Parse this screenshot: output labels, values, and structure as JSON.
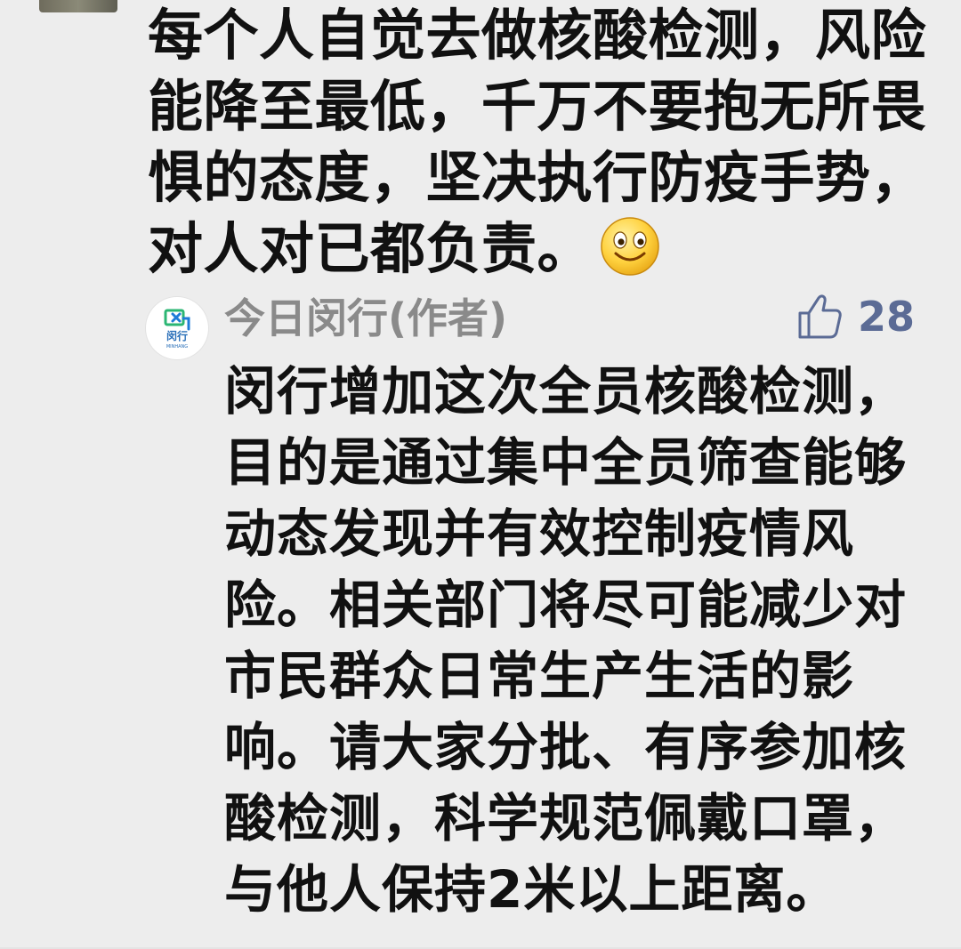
{
  "comment": {
    "text": "每个人自觉去做核酸检测，风险能降至最低，千万不要抱无所畏惧的态度，坚决执行防疫手势，对人对已都负责。",
    "emoji": "smile-emoji"
  },
  "reply": {
    "author": "今日闵行(作者)",
    "avatar_logo": {
      "name": "闵行",
      "sub": "MINHANG"
    },
    "like_count": "28",
    "text": "闵行增加这次全员核酸检测，目的是通过集中全员筛查能够动态发现并有效控制疫情风险。相关部门将尽可能减少对市民群众日常生产生活的影响。请大家分批、有序参加核酸检测，科学规范佩戴口罩，与他人保持2米以上距离。"
  },
  "colors": {
    "background": "#ededed",
    "text": "#111111",
    "author": "#8a8a8a",
    "like": "#5b6b95",
    "logo_green": "#2bb673",
    "logo_blue": "#1e7bd8"
  }
}
